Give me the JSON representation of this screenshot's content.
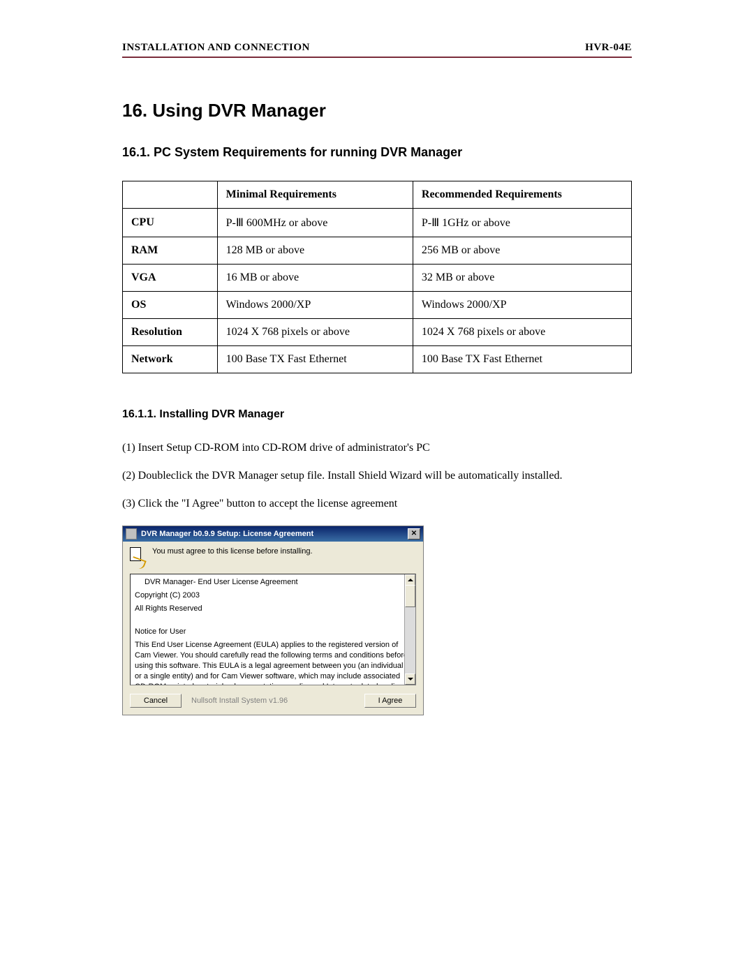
{
  "header": {
    "left": "INSTALLATION AND CONNECTION",
    "right": "HVR-04E"
  },
  "h1": "16. Using DVR Manager",
  "h2": "16.1. PC System Requirements for running DVR Manager",
  "table": {
    "headers": [
      "",
      "Minimal Requirements",
      "Recommended Requirements"
    ],
    "rows": [
      {
        "label": "CPU",
        "min": "P-Ⅲ  600MHz or above",
        "rec": "P-Ⅲ  1GHz or above"
      },
      {
        "label": "RAM",
        "min": "128 MB or above",
        "rec": "256 MB or above"
      },
      {
        "label": "VGA",
        "min": "16 MB or above",
        "rec": "32 MB or above"
      },
      {
        "label": "OS",
        "min": "Windows 2000/XP",
        "rec": "Windows 2000/XP"
      },
      {
        "label": "Resolution",
        "min": "1024 X 768 pixels or above",
        "rec": "1024 X 768 pixels or above"
      },
      {
        "label": "Network",
        "min": "100 Base TX Fast Ethernet",
        "rec": "100 Base TX Fast Ethernet"
      }
    ]
  },
  "h3": "16.1.1. Installing DVR Manager",
  "steps": [
    "(1) Insert Setup CD-ROM into CD-ROM drive of administrator's PC",
    "(2) Doubleclick the DVR Manager setup file. Install Shield Wizard will be automatically installed.",
    "(3) Click the \"I Agree\" button to accept the license agreement"
  ],
  "dialog": {
    "title": "DVR Manager b0.9.9 Setup: License Agreement",
    "instruction": "You must agree to this license before installing.",
    "eula": {
      "l1_indent": "DVR Manager- End User License Agreement",
      "l2": "Copyright (C) 2003",
      "l3": "All Rights Reserved",
      "l4": "Notice for User",
      "l5": "This End User License Agreement (EULA) applies to the registered version of Cam Viewer. You should carefully read the following terms and conditions before using this software. This EULA is a legal agreement between you (an individual or a single entity) and                     for Cam Viewer software, which may include associated CD-ROM, printed materials, documentation, media, and Internet related on-line documentation. By installing, copying, or using this product, you agree to be bound by the terms of this EULA. If you do not agree"
    },
    "footer_text": "Nullsoft Install System v1.96",
    "cancel_label": "Cancel",
    "agree_label": "I Agree"
  }
}
